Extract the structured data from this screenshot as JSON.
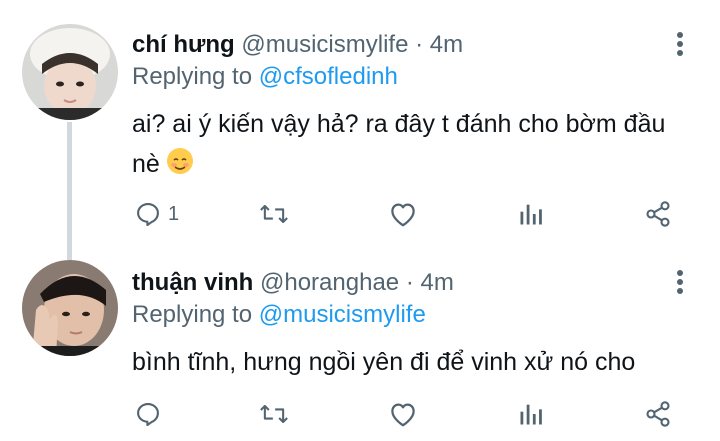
{
  "tweets": [
    {
      "name": "chí hưng",
      "handle": "@musicismylife",
      "dot": "·",
      "time": "4m",
      "replying_prefix": "Replying to",
      "replying_to": "@cfsofledinh",
      "text": "ai? ai ý kiến vậy hả? ra đây t đánh cho bờm đầu nè",
      "emoji": "☺️",
      "reply_count": "1"
    },
    {
      "name": "thuận vinh",
      "handle": "@horanghae",
      "dot": "·",
      "time": "4m",
      "replying_prefix": "Replying to",
      "replying_to": "@musicismylife",
      "text": "bình tĩnh, hưng ngồi yên đi để vinh xử nó cho",
      "reply_count": ""
    }
  ],
  "icons": {
    "reply": "reply-icon",
    "retweet": "retweet-icon",
    "like": "like-icon",
    "views": "analytics-icon",
    "share": "share-icon",
    "more": "more-options-icon"
  },
  "colors": {
    "text": "#0f1419",
    "secondary": "#536471",
    "link": "#1d9bf0",
    "thread_line": "#cfd9de"
  }
}
